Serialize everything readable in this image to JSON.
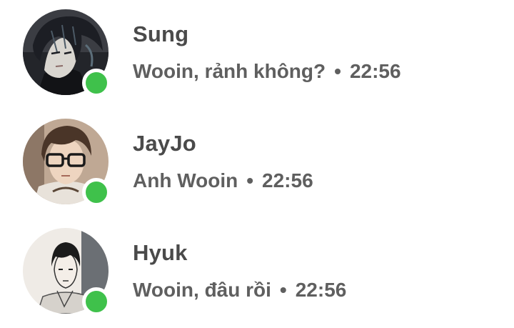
{
  "colors": {
    "online": "#3fc14b",
    "name_text": "#4a4a4a",
    "preview_text": "#5f5f5f",
    "background": "#ffffff"
  },
  "conversations": [
    {
      "name": "Sung",
      "message": "Wooin, rảnh không?",
      "separator": "•",
      "time": "22:56",
      "online": true,
      "avatar_icon": "avatar-sung"
    },
    {
      "name": "JayJo",
      "message": "Anh Wooin",
      "separator": "•",
      "time": "22:56",
      "online": true,
      "avatar_icon": "avatar-jayjo"
    },
    {
      "name": "Hyuk",
      "message": "Wooin, đâu rồi",
      "separator": "•",
      "time": "22:56",
      "online": true,
      "avatar_icon": "avatar-hyuk"
    }
  ]
}
